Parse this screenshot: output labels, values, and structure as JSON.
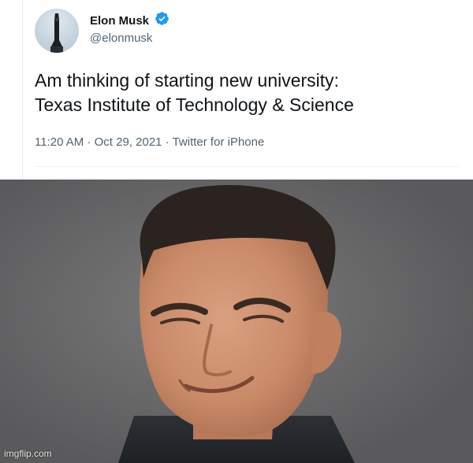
{
  "tweet": {
    "author": {
      "display_name": "Elon Musk",
      "handle": "@elonmusk",
      "verified": true,
      "avatar_icon": "starship-avatar"
    },
    "text_lines": [
      "Am thinking of starting new university:",
      "Texas Institute of Technology & Science"
    ],
    "time": "11:20 AM",
    "date": "Oct 29, 2021",
    "source": "Twitter for iPhone",
    "separator": "·"
  },
  "photo": {
    "subject": "smirking-young-man-photo"
  },
  "watermark": "imgflip.com",
  "colors": {
    "text_primary": "#0f1419",
    "text_secondary": "#536471",
    "verified_blue": "#1d9bf0"
  }
}
